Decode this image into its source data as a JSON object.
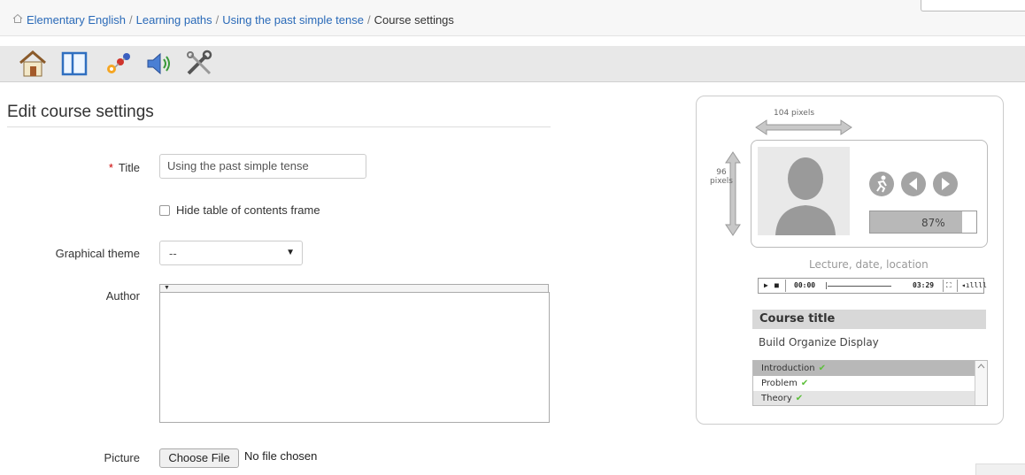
{
  "breadcrumb": {
    "items": [
      "Elementary English",
      "Learning paths",
      "Using the past simple tense"
    ],
    "current": "Course settings",
    "separator": "/"
  },
  "toolbar": {
    "tools": [
      "home-icon",
      "toc-layout-icon",
      "build-icon",
      "audio-icon",
      "settings-icon"
    ]
  },
  "page": {
    "title": "Edit course settings"
  },
  "form": {
    "title_label": "Title",
    "required_mark": "*",
    "title_value": "Using the past simple tense",
    "hide_toc_label": "Hide table of contents frame",
    "theme_label": "Graphical theme",
    "theme_value": "--",
    "author_label": "Author",
    "picture_label": "Picture",
    "choose_file": "Choose File",
    "no_file": "No file chosen"
  },
  "preview": {
    "width_label": "104 pixels",
    "height_num": "96",
    "height_unit": "pixels",
    "progress": 0.87,
    "progress_text": "87%",
    "lecture": "Lecture, date, location",
    "media_start": "00:00",
    "media_end": "03:29",
    "course_title": "Course title",
    "menu": [
      "Build",
      "Organize",
      "Display"
    ],
    "toc": [
      "Introduction",
      "Problem",
      "Theory"
    ],
    "colors": {
      "check": "#5cbf3a",
      "accent": "#2a6ab8"
    }
  }
}
